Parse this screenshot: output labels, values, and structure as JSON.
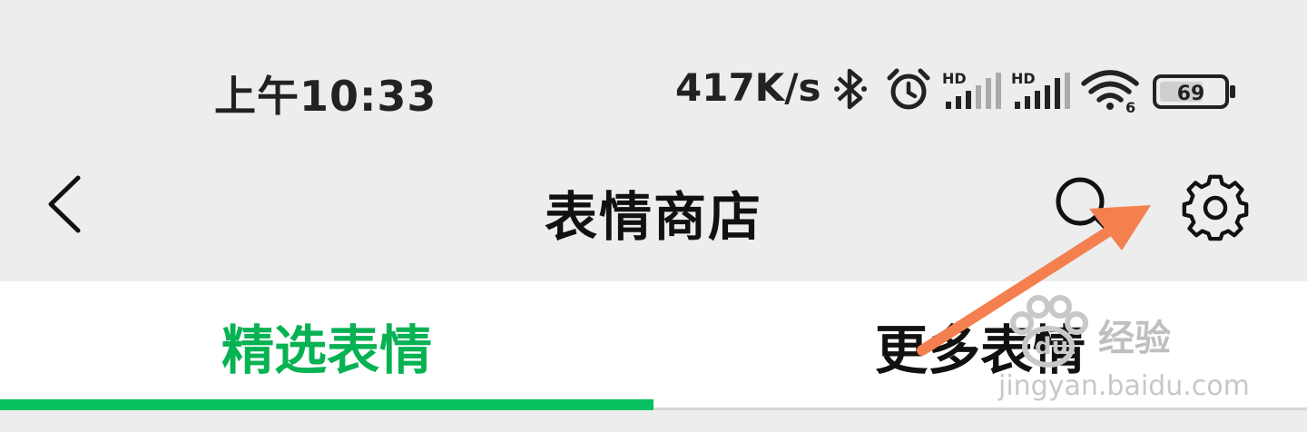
{
  "status_bar": {
    "time": "上午10:33",
    "network_speed": "417K/s",
    "icons": [
      "bluetooth-icon",
      "alarm-icon",
      "hd-signal-icon",
      "hd-signal-icon",
      "wifi-icon",
      "battery-icon"
    ],
    "hd_label": "HD",
    "wifi_label": "6",
    "battery_level": "69"
  },
  "header": {
    "back_icon": "chevron-left-icon",
    "title": "表情商店",
    "search_icon": "search-icon",
    "settings_icon": "gear-icon"
  },
  "tabs": [
    {
      "label": "精选表情",
      "selected": true
    },
    {
      "label": "更多表情",
      "selected": false
    }
  ],
  "watermark": {
    "brand": "经验",
    "site": "jingyan.baidu.com"
  },
  "colors": {
    "accent": "#07c160",
    "annotation_arrow": "#f47f4f",
    "background": "#ededed"
  }
}
